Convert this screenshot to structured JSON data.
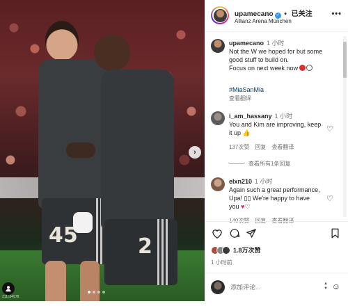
{
  "header": {
    "username": "upamecano",
    "verified_icon": "verified-badge-icon",
    "separator": "•",
    "follow_status": "已关注",
    "location": "Allianz Arena München",
    "more_icon": "more-horizontal-icon"
  },
  "caption": {
    "username": "upamecano",
    "time": "1 小时",
    "text_line1": "Not the W we hoped for but some",
    "text_line2": "good stuff to build on.",
    "text_line3": "Focus on next week now",
    "hashtag": "#MiaSanMia",
    "translate": "查看翻译"
  },
  "comments": [
    {
      "username": "i_am_hassany",
      "time": "1 小时",
      "text_line1": "You and Kim are improving, keep",
      "text_line2": "it up",
      "likes": "137次赞",
      "reply": "回复",
      "translate": "查看翻译",
      "view_replies": "查看所有1条回复"
    },
    {
      "username": "elxn210",
      "time": "1 小时",
      "text_line1": "Again such a great performance,",
      "text_line2": "Upa! ▯▯ We're happy to have",
      "text_line3": "you",
      "likes": "140次赞",
      "reply": "回复",
      "translate": "查看翻译"
    }
  ],
  "actions": {
    "like_icon": "heart-icon",
    "comment_icon": "comment-icon",
    "share_icon": "send-icon",
    "save_icon": "bookmark-icon"
  },
  "likes": {
    "count": "1.8万次赞"
  },
  "post_time": "1 小时前",
  "add_comment": {
    "placeholder": "添加评论..."
  },
  "photo": {
    "jersey_left": "45",
    "jersey_right": "2",
    "credit": "211cd4978"
  },
  "colors": {
    "accent_blue": "#3897f0",
    "hashtag_blue": "#00376b",
    "text": "#262626",
    "muted": "#737373"
  }
}
